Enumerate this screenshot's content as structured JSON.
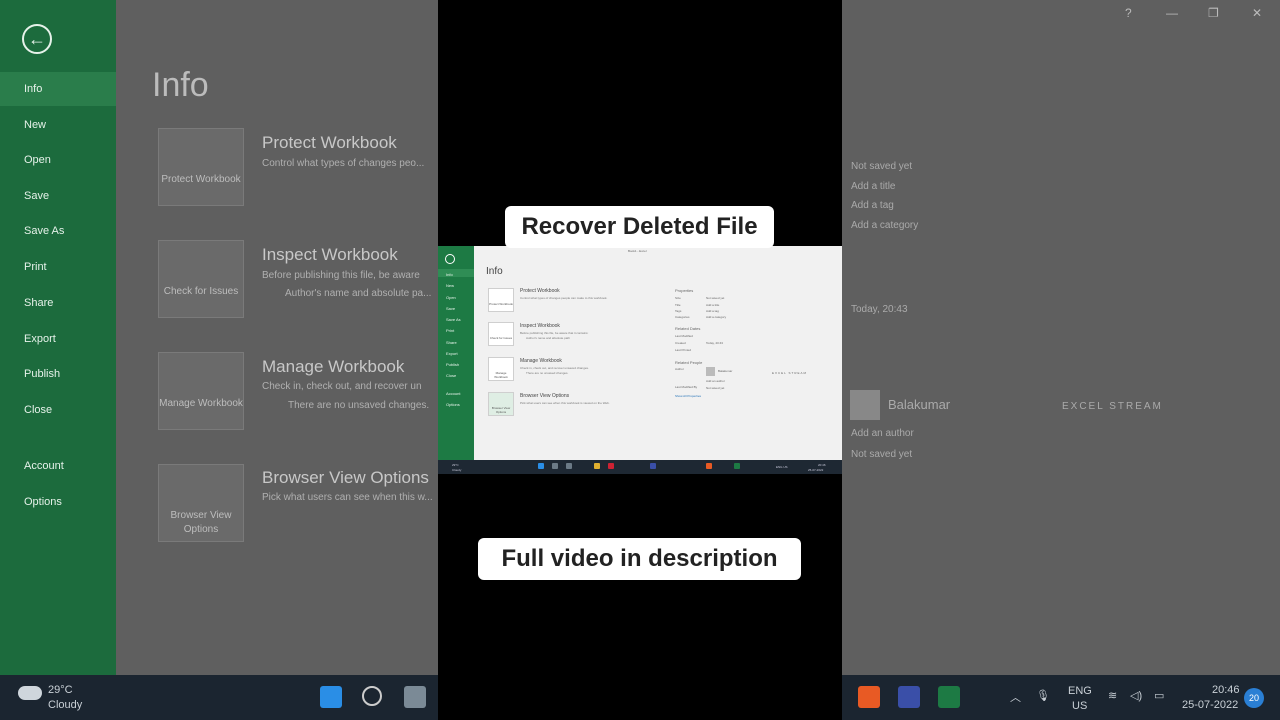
{
  "overlay": {
    "top_caption": "Recover Deleted File",
    "bottom_caption": "Full video in description"
  },
  "background_app": {
    "back_icon": "arrow-left-icon",
    "sidebar_items": [
      "Info",
      "New",
      "Open",
      "Save",
      "Save As",
      "Print",
      "Share",
      "Export",
      "Publish",
      "Close",
      "Account",
      "Options"
    ],
    "page_title": "Info",
    "cards": [
      {
        "label": "Protect Workbook",
        "title": "Protect Workbook",
        "desc": "Control what types of changes peo..."
      },
      {
        "label": "Check for Issues",
        "title": "Inspect Workbook",
        "desc": "Before publishing this file, be aware",
        "bullet": "Author's name and absolute pa..."
      },
      {
        "label": "Manage Workbook",
        "title": "Manage Workbook",
        "desc": "Check in, check out, and recover un",
        "bullet": "There are no unsaved changes."
      },
      {
        "label": "Browser View Options",
        "title": "Browser View Options",
        "desc": "Pick what users can see when this w..."
      }
    ],
    "right_panel": {
      "not_saved": "Not saved yet",
      "add_title": "Add a title",
      "add_tag": "Add a tag",
      "add_category": "Add a category",
      "created": "Today, 20:43",
      "author": "Balakumar",
      "watermark": "EXCEL STREAM",
      "add_author": "Add an author",
      "not_saved_2": "Not saved yet"
    },
    "window_controls": [
      "?",
      "—",
      "❐",
      "✕"
    ]
  },
  "inner_screenshot": {
    "window_title": "Book1 - Excel",
    "sidebar_items": [
      "Info",
      "New",
      "Open",
      "Save",
      "Save As",
      "Print",
      "Share",
      "Export",
      "Publish",
      "Close",
      "Account",
      "Options"
    ],
    "page_title": "Info",
    "sections": [
      {
        "card": "Protect Workbook",
        "title": "Protect Workbook",
        "desc": "Control what types of changes people can make to this workbook."
      },
      {
        "card": "Check for Issues",
        "title": "Inspect Workbook",
        "desc": "Before publishing this file, be aware that it contains:",
        "bullet": "Author's name and absolute path"
      },
      {
        "card": "Manage Workbook",
        "title": "Manage Workbook",
        "desc": "Check in, check out, and recover unsaved changes.",
        "bullet": "There are no unsaved changes."
      },
      {
        "card": "Browser View Options",
        "title": "Browser View Options",
        "desc": "Pick what users can see when this workbook is viewed on the Web."
      }
    ],
    "properties": {
      "header": "Properties",
      "rows": [
        {
          "k": "Size",
          "v": "Not saved yet"
        },
        {
          "k": "Title",
          "v": "Add a title"
        },
        {
          "k": "Tags",
          "v": "Add a tag"
        },
        {
          "k": "Categories",
          "v": "Add a category"
        }
      ],
      "related_dates": "Related Dates",
      "dates": [
        {
          "k": "Last Modified",
          "v": ""
        },
        {
          "k": "Created",
          "v": "Today, 20:43"
        },
        {
          "k": "Last Printed",
          "v": ""
        }
      ],
      "related_people": "Related People",
      "author_label": "Author",
      "author_name": "Balakumar",
      "watermark": "EXCEL STREAM",
      "add_author": "Add an author",
      "last_modified_by": "Last Modified By",
      "not_saved": "Not saved yet",
      "show_all": "Show All Properties"
    },
    "taskbar": {
      "weather_temp": "29°C",
      "weather_desc": "Cloudy",
      "lang": "ENG US",
      "time": "20:46",
      "date": "25-07-2022"
    }
  },
  "taskbar": {
    "weather_temp": "29°C",
    "weather_desc": "Cloudy",
    "lang_1": "ENG",
    "lang_2": "US",
    "time": "20:46",
    "date": "25-07-2022",
    "notification_count": "20"
  }
}
